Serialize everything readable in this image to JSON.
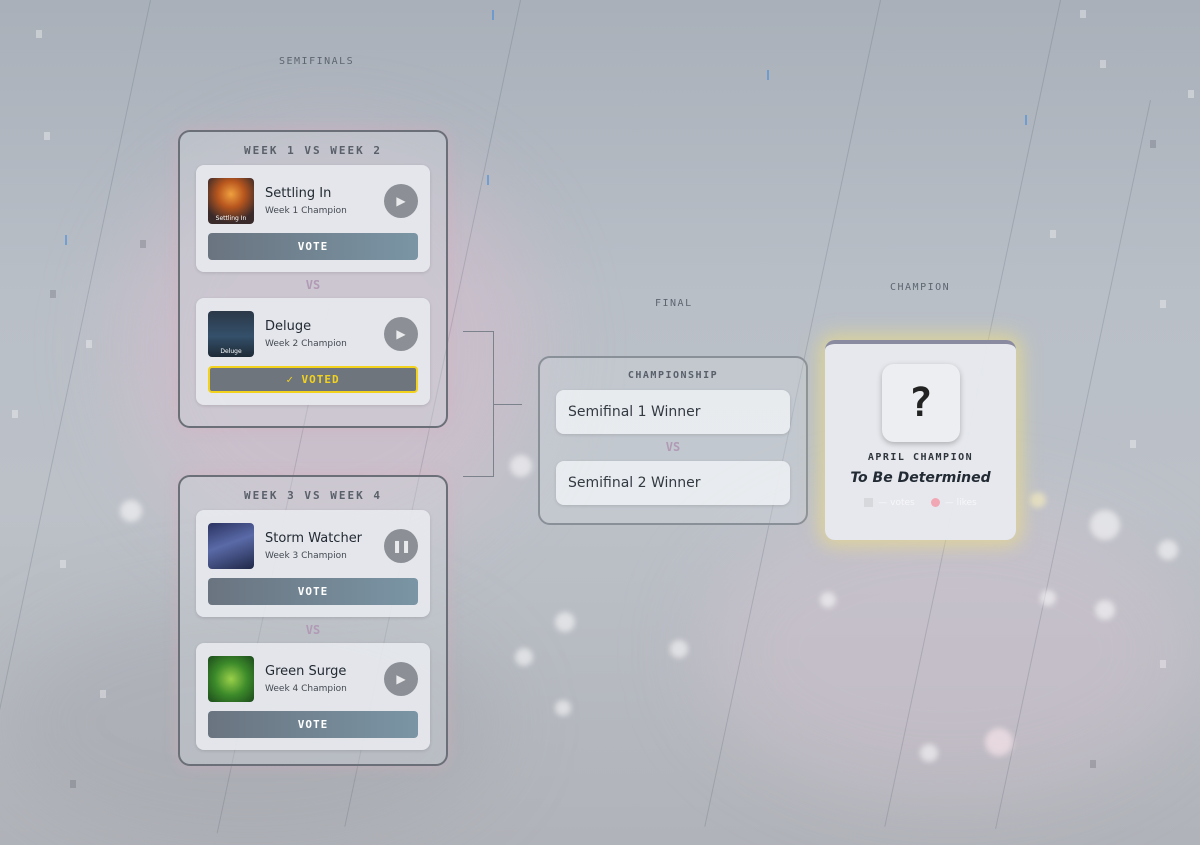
{
  "stages": {
    "semifinals": "SEMIFINALS",
    "final": "FINAL",
    "champion": "CHAMPION"
  },
  "semifinals": [
    {
      "title": "WEEK 1 VS WEEK 2",
      "vs": "VS",
      "entries": [
        {
          "song": "Settling In",
          "subtitle": "Week 1 Champion",
          "art_caption": "Settling In",
          "play_icon": "play-icon",
          "vote_label": "VOTE",
          "voted": false
        },
        {
          "song": "Deluge",
          "subtitle": "Week 2 Champion",
          "art_caption": "Deluge",
          "play_icon": "play-icon",
          "vote_label": "✓ VOTED",
          "voted": true
        }
      ]
    },
    {
      "title": "WEEK 3 VS WEEK 4",
      "vs": "VS",
      "entries": [
        {
          "song": "Storm Watcher",
          "subtitle": "Week 3 Champion",
          "art_caption": "",
          "play_icon": "pause-icon",
          "vote_label": "VOTE",
          "voted": false
        },
        {
          "song": "Green Surge",
          "subtitle": "Week 4 Champion",
          "art_caption": "",
          "play_icon": "play-icon",
          "vote_label": "VOTE",
          "voted": false
        }
      ]
    }
  ],
  "final": {
    "title": "CHAMPIONSHIP",
    "slot1": "Semifinal 1 Winner",
    "vs": "VS",
    "slot2": "Semifinal 2 Winner"
  },
  "champion": {
    "symbol": "?",
    "label": "APRIL CHAMPION",
    "name": "To Be Determined",
    "votes": "— votes",
    "likes": "— likes"
  },
  "colors": {
    "voted_accent": "#f3d21e",
    "vs_color": "#b19ab5",
    "champion_glow": "#f5e178"
  }
}
